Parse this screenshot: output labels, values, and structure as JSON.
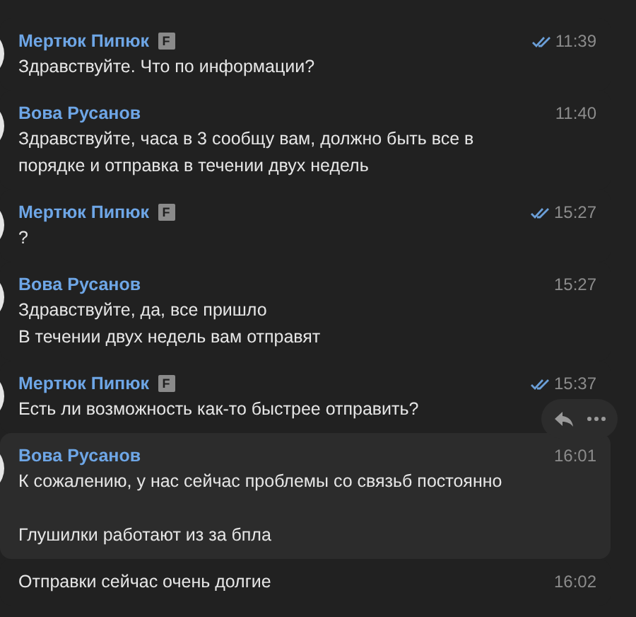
{
  "messages": [
    {
      "author": "Мертюк Пипюк",
      "badge": "F",
      "read": true,
      "time": "11:39",
      "text": "Здравствуйте. Что по информации?",
      "hovered": false
    },
    {
      "author": "Вова Русанов",
      "read": false,
      "time": "11:40",
      "text": "Здравствуйте, часа в 3 сообщу вам, должно быть все в порядке и отправка в течении двух недель",
      "hovered": false
    },
    {
      "author": "Мертюк Пипюк",
      "badge": "F",
      "read": true,
      "time": "15:27",
      "text": "?",
      "hovered": false
    },
    {
      "author": "Вова Русанов",
      "read": false,
      "time": "15:27",
      "text": "Здравствуйте, да, все пришло\nВ течении двух недель вам отправят",
      "hovered": false
    },
    {
      "author": "Мертюк Пипюк",
      "badge": "F",
      "read": true,
      "time": "15:37",
      "text": "Есть ли возможность как-то быстрее отправить?",
      "hovered": false
    },
    {
      "author": "Вова Русанов",
      "read": false,
      "time": "16:01",
      "text": "К сожалению, у нас сейчас проблемы со связьб постоянно\n\nГлушилки работают из за бпла",
      "hovered": true
    },
    {
      "read": false,
      "time": "16:02",
      "text": "Отправки сейчас очень долгие",
      "hovered": false
    }
  ]
}
